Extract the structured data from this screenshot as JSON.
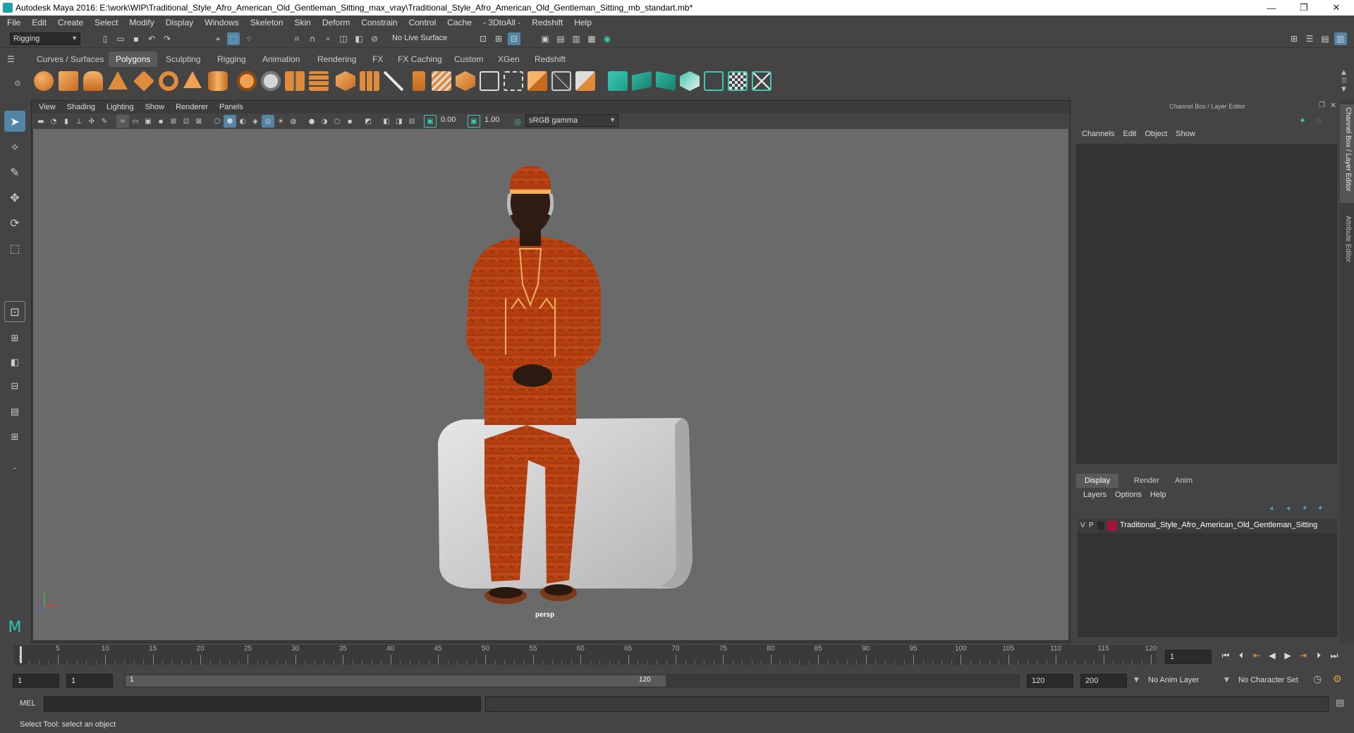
{
  "window": {
    "title": "Autodesk Maya 2016: E:\\work\\WIP\\Traditional_Style_Afro_American_Old_Gentleman_Sitting_max_vray\\Traditional_Style_Afro_American_Old_Gentleman_Sitting_mb_standart.mb*",
    "minimize": "—",
    "restore": "❐",
    "close": "✕"
  },
  "menubar": [
    "File",
    "Edit",
    "Create",
    "Select",
    "Modify",
    "Display",
    "Windows",
    "Skeleton",
    "Skin",
    "Deform",
    "Constrain",
    "Control",
    "Cache",
    "- 3DtoAll -",
    "Redshift",
    "Help"
  ],
  "statusline": {
    "menuset": "Rigging",
    "live_surface": "No Live Surface"
  },
  "shelf": {
    "tabs": [
      "Curves / Surfaces",
      "Polygons",
      "Sculpting",
      "Rigging",
      "Animation",
      "Rendering",
      "FX",
      "FX Caching",
      "Custom",
      "XGen",
      "Redshift"
    ],
    "active_tab": "Polygons"
  },
  "viewport": {
    "menu": [
      "View",
      "Shading",
      "Lighting",
      "Show",
      "Renderer",
      "Panels"
    ],
    "exposure": "0.00",
    "gamma": "1.00",
    "color_space": "sRGB gamma",
    "camera_label": "persp"
  },
  "channelbox": {
    "title": "Channel Box / Layer Editor",
    "menu": [
      "Channels",
      "Edit",
      "Object",
      "Show"
    ],
    "layer_tabs": [
      "Display",
      "Render",
      "Anim"
    ],
    "active_layer_tab": "Display",
    "layer_menu": [
      "Layers",
      "Options",
      "Help"
    ],
    "layer": {
      "visible": "V",
      "playback": "P",
      "name": "Traditional_Style_Afro_American_Old_Gentleman_Sitting",
      "color": "#a3153a"
    }
  },
  "sidetabs": [
    "Channel Box / Layer Editor",
    "Attribute Editor"
  ],
  "timeline": {
    "ticks": [
      "1",
      "5",
      "10",
      "15",
      "20",
      "25",
      "30",
      "35",
      "40",
      "45",
      "50",
      "55",
      "60",
      "65",
      "70",
      "75",
      "80",
      "85",
      "90",
      "95",
      "100",
      "105",
      "110",
      "115",
      "120"
    ],
    "current_frame": "1"
  },
  "range": {
    "start": "1",
    "playback_start": "1",
    "slider_start": "1",
    "slider_end": "120",
    "playback_end": "120",
    "end": "200",
    "anim_layer": "No Anim Layer",
    "character_set": "No Character Set"
  },
  "cmdline": {
    "label": "MEL"
  },
  "helpline": "Select Tool: select an object",
  "colors": {
    "accent": "#5285a6",
    "shelf_teal": "#1b9e8a",
    "shelf_orange": "#e08a3c"
  }
}
